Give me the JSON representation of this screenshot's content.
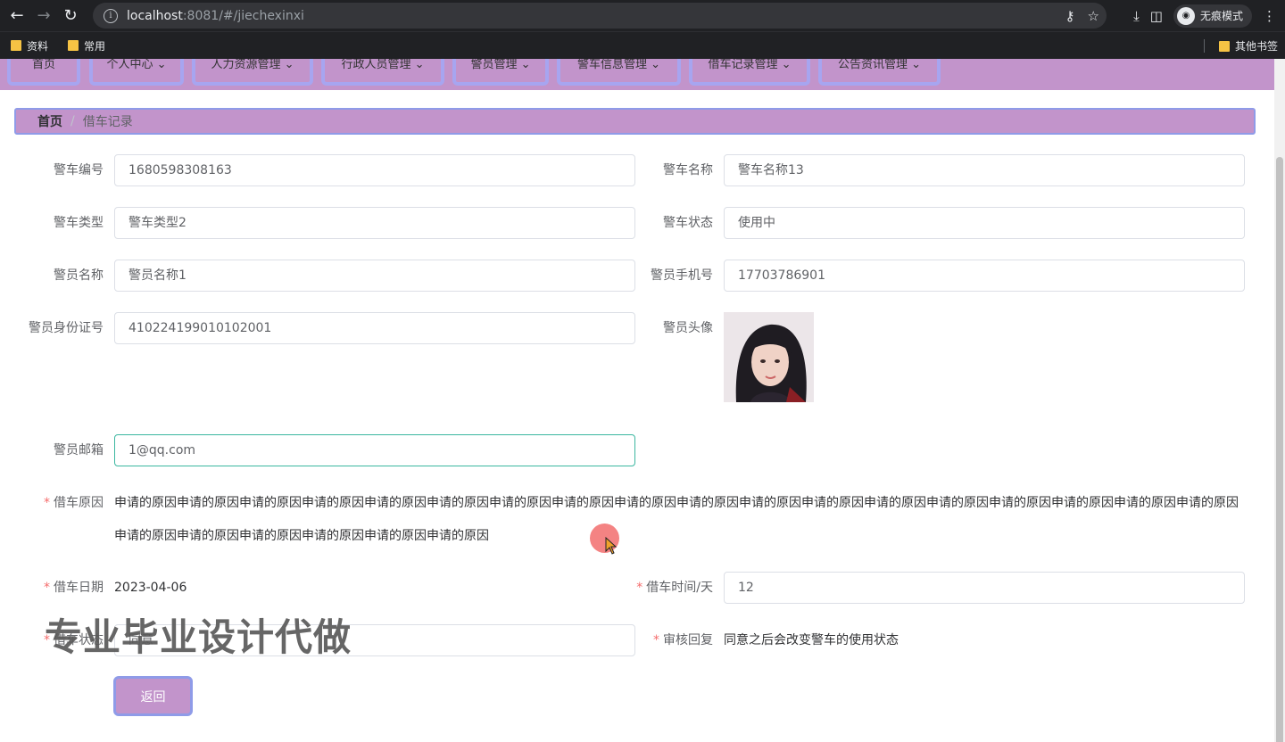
{
  "browser": {
    "url_host": "localhost",
    "url_path": ":8081/#/jiechexinxi",
    "incognito_label": "无痕模式",
    "bookmarks": [
      "资料",
      "常用"
    ],
    "other_bookmarks": "其他书签"
  },
  "nav": {
    "tabs": [
      "首页",
      "个人中心",
      "人力资源管理",
      "行政人员管理",
      "警员管理",
      "警车信息管理",
      "借车记录管理",
      "公告资讯管理"
    ]
  },
  "breadcrumb": {
    "home": "首页",
    "separator": "/",
    "current": "借车记录"
  },
  "form": {
    "car_no_label": "警车编号",
    "car_no": "1680598308163",
    "car_name_label": "警车名称",
    "car_name": "警车名称13",
    "car_type_label": "警车类型",
    "car_type": "警车类型2",
    "car_status_label": "警车状态",
    "car_status": "使用中",
    "officer_name_label": "警员名称",
    "officer_name": "警员名称1",
    "officer_phone_label": "警员手机号",
    "officer_phone": "17703786901",
    "officer_id_label": "警员身份证号",
    "officer_id": "410224199010102001",
    "officer_avatar_label": "警员头像",
    "officer_email_label": "警员邮箱",
    "officer_email": "1@qq.com",
    "reason_label": "借车原因",
    "reason": "申请的原因申请的原因申请的原因申请的原因申请的原因申请的原因申请的原因申请的原因申请的原因申请的原因申请的原因申请的原因申请的原因申请的原因申请的原因申请的原因申请的原因申请的原因申请的原因申请的原因申请的原因申请的原因申请的原因申请的原因",
    "borrow_date_label": "借车日期",
    "borrow_date": "2023-04-06",
    "borrow_days_label": "借车时间/天",
    "borrow_days": "12",
    "borrow_status_label": "借车状态",
    "borrow_status": "同意",
    "review_reply_label": "审核回复",
    "review_reply": "同意之后会改变警车的使用状态",
    "required_mark": "*"
  },
  "buttons": {
    "back": "返回"
  },
  "watermark": "专业毕业设计代做",
  "colors": {
    "accent": "#c294cb",
    "accent_border": "#8f9be8",
    "required": "#f56c6c",
    "focus": "#3bb7a0"
  }
}
